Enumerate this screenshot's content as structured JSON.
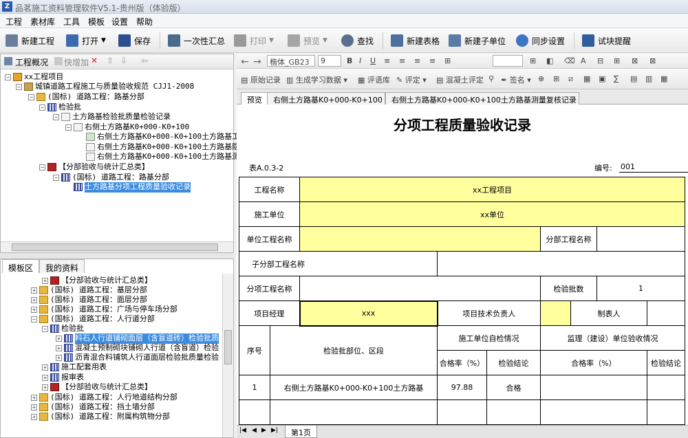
{
  "app": {
    "title": "品茗施工资料管理软件V5.1-贵州版（体验版）"
  },
  "menu": [
    "工程",
    "素材库",
    "工具",
    "模板",
    "设置",
    "帮助"
  ],
  "toolbar": {
    "new_project": "新建工程",
    "open": "打开",
    "save": "保存",
    "summary": "一次性汇总",
    "print": "打印",
    "preview": "预览",
    "find": "查找",
    "new_table": "新建表格",
    "new_subunit": "新建子单位",
    "sync": "同步设置",
    "reminder": "试块提醒"
  },
  "left_panel": {
    "overview": "工程概况",
    "quick_add": "快增加",
    "tree": [
      "xx工程项目",
      "城镇道路工程施工与质量验收规范 CJJ1-2008",
      "(国标) 道路工程：路基分部",
      "检验批",
      "土方路基检验批质量检验记录",
      "右侧土方路基K0+000-K0+100",
      "右侧土方路基K0+000-K0+100土方路基工",
      "右侧土方路基K0+000-K0+100土方路基隐",
      "右侧土方路基K0+000-K0+100土方路基测",
      "【分部验收与统计汇总类】",
      "(国标) 道路工程：路基分部",
      "土方路基分项工程质量验收记录"
    ],
    "tabs": [
      "模板区",
      "我的资料"
    ],
    "template_tree": [
      "【分部验收与统计汇总类】",
      "(国标) 道路工程：基层分部",
      "(国标) 道路工程：面层分部",
      "(国标) 道路工程：广场与停车场分部",
      "(国标) 道路工程：人行道分部",
      "检验批",
      "料石人行道铺砌面层（含盲道砖）检验批质",
      "混凝土预制砌块铺砌人行道（含盲道）检验",
      "沥青混合料铺筑人行道面层检验批质量检验",
      "施工配套用表",
      "报审表",
      "【分部验收与统计汇总类】",
      "(国标) 道路工程：人行地道结构分部",
      "(国标) 道路工程：挡土墙分部",
      "(国标) 道路工程：附属构筑物分部"
    ]
  },
  "format_bar": {
    "font": "楷体_GB23",
    "size": "9",
    "original_record": "原始记录",
    "learn_data": "生成学习数据",
    "comment_lib": "评语库",
    "evaluate": "评定",
    "concrete_eval": "混凝土评定",
    "sign": "签名"
  },
  "doc_tabs": [
    "预览",
    "右侧土方路基K0+000-K0+100",
    "右侧土方路基K0+000-K0+100土方路基测量复核记录"
  ],
  "form": {
    "title": "分项工程质量验收记录",
    "table_no": "表A.0.3-2",
    "number_label": "编号:",
    "number_value": "001",
    "project_name_label": "工程名称",
    "project_name": "xx工程项目",
    "construction_unit_label": "施工单位",
    "construction_unit": "xx单位",
    "unit_project_label": "单位工程名称",
    "division_label": "分部工程名称",
    "subunit_label": "子分部工程名称",
    "subitem_label": "分项工程名称",
    "batch_count_label": "检验批数",
    "batch_count": "1",
    "manager_label": "项目经理",
    "manager": "xxx",
    "tech_lead_label": "项目技术负责人",
    "preparer_label": "制表人",
    "col_seq": "序号",
    "col_location": "检验批部位、区段",
    "col_self_check": "施工单位自检情况",
    "col_supervision": "监理（建设）单位验收情况",
    "col_pass_rate": "合格率（%）",
    "col_conclusion": "检验结论",
    "rows": [
      {
        "seq": "1",
        "location": "右侧土方路基K0+000-K0+100土方路基",
        "rate": "97.88",
        "conclusion": "合格"
      }
    ]
  },
  "sheet_tab": "第1页"
}
